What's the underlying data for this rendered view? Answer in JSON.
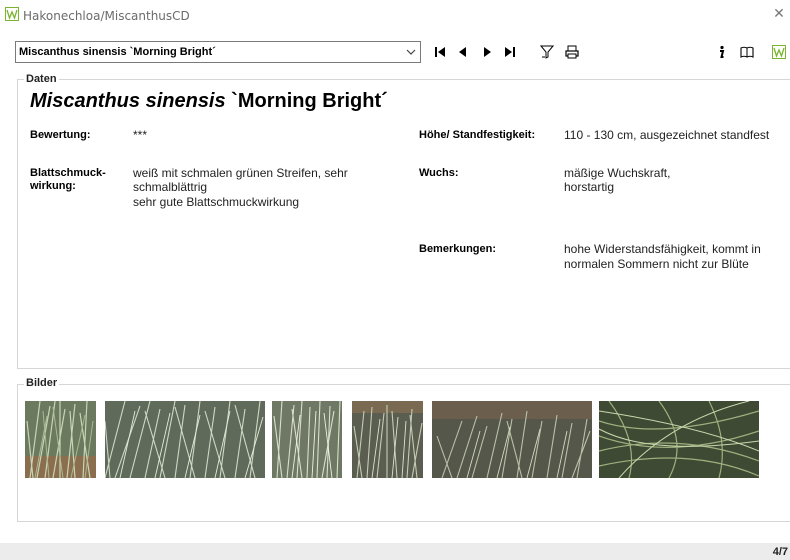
{
  "window": {
    "title": "Hakonechloa/MiscanthusCD",
    "close_glyph": "✕",
    "app_icon": "app-logo-icon"
  },
  "toolbar": {
    "selected_plant": "Miscanthus sinensis `Morning Bright´",
    "icons": [
      "first-record-icon",
      "previous-record-icon",
      "next-record-icon",
      "last-record-icon",
      "filter-icon",
      "print-icon",
      "info-icon",
      "book-icon",
      "app-logo-icon"
    ]
  },
  "daten": {
    "group_label": "Daten",
    "title_latin": "Miscanthus sinensis",
    "title_cultivar": " `Morning Bright´",
    "bewertung_label": "Bewertung:",
    "bewertung_value": "***",
    "blatt_label_line1": "Blattschmuck-",
    "blatt_label_line2": "wirkung:",
    "blatt_value_line1": "weiß mit schmalen grünen Streifen, sehr",
    "blatt_value_line2": "schmalblättrig",
    "blatt_value_line3": "sehr gute Blattschmuckwirkung",
    "hoehe_label": "Höhe/ Standfestigkeit:",
    "hoehe_value": "110 - 130 cm, ausgezeichnet standfest",
    "wuchs_label": "Wuchs:",
    "wuchs_value_line1": "mäßige Wuchskraft,",
    "wuchs_value_line2": "horstartig",
    "bemerkungen_label": "Bemerkungen:",
    "bemerkungen_value_line1": "hohe Widerstandsfähigkeit, kommt in",
    "bemerkungen_value_line2": "normalen Sommern nicht zur Blüte"
  },
  "bilder": {
    "group_label": "Bilder",
    "image_count": 6
  },
  "status": {
    "page_counter": "4/7"
  },
  "colors": {
    "logo_green": "#7ab32e",
    "group_border": "#d6d6d6",
    "status_bar": "#ececec"
  }
}
